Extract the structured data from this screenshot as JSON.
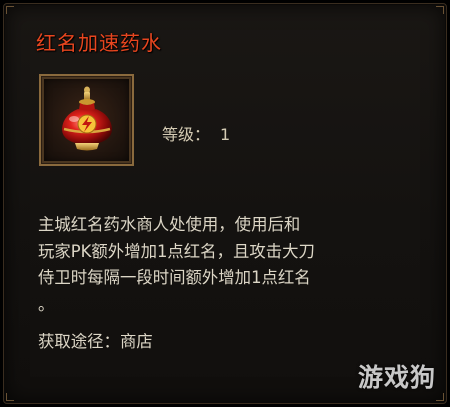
{
  "item": {
    "name": "红名加速药水",
    "icon": "red-potion-icon",
    "name_color": "#e8461f",
    "level_label": "等级：",
    "level_value": "1"
  },
  "description_lines": [
    "主城红名药水商人处使用，使用后和",
    "玩家PK额外增加1点红名，且攻击大刀",
    "侍卫时每隔一段时间额外增加1点红名",
    "。"
  ],
  "source": {
    "label": "获取途径：",
    "value": "商店"
  },
  "watermark": "游戏狗"
}
